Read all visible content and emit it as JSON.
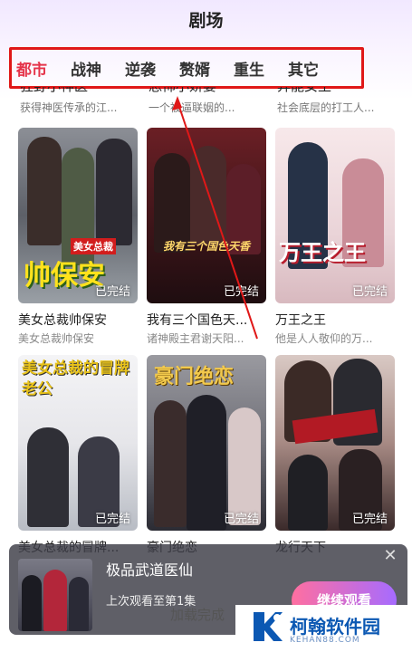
{
  "header": {
    "title": "剧场"
  },
  "tabs": [
    {
      "label": "都市",
      "active": true
    },
    {
      "label": "战神"
    },
    {
      "label": "逆袭"
    },
    {
      "label": "赘婿"
    },
    {
      "label": "重生"
    },
    {
      "label": "其它"
    }
  ],
  "clipped_row": [
    {
      "title": "狂野小神医",
      "sub": "获得神医传承的江..."
    },
    {
      "title": "恐怖小娇妻",
      "sub": "一个被逼联姻的..."
    },
    {
      "title": "异能女王",
      "sub": "社会底层的打工人..."
    }
  ],
  "cards": [
    {
      "title": "美女总裁帅保安",
      "sub": "美女总裁帅保安",
      "status": "已完结",
      "overlay": "帅保安",
      "overlay_top": "美女总裁"
    },
    {
      "title": "我有三个国色天...",
      "sub": "诸神殿主君谢天阳...",
      "status": "已完结",
      "overlay": "我有三个国色天香"
    },
    {
      "title": "万王之王",
      "sub": "他是人人敬仰的万...",
      "status": "已完结",
      "overlay": "万王之王"
    },
    {
      "title": "美女总裁的冒牌...",
      "sub": "",
      "status": "已完结",
      "overlay": "美女总裁的冒牌老公"
    },
    {
      "title": "豪门绝恋",
      "sub": "",
      "status": "已完结",
      "overlay": "豪门绝恋"
    },
    {
      "title": "龙行天下",
      "sub": "",
      "status": "已完结",
      "overlay": ""
    }
  ],
  "banner": {
    "title": "极品武道医仙",
    "sub": "上次观看至第1集",
    "button": "继续观看",
    "close": "✕"
  },
  "footer": {
    "loading": "加载完成"
  },
  "watermark": {
    "name": "柯翰软件园",
    "url": "KEHAN88.COM"
  },
  "colors": {
    "accent": "#e5344a",
    "highlight_box": "#e01818"
  }
}
